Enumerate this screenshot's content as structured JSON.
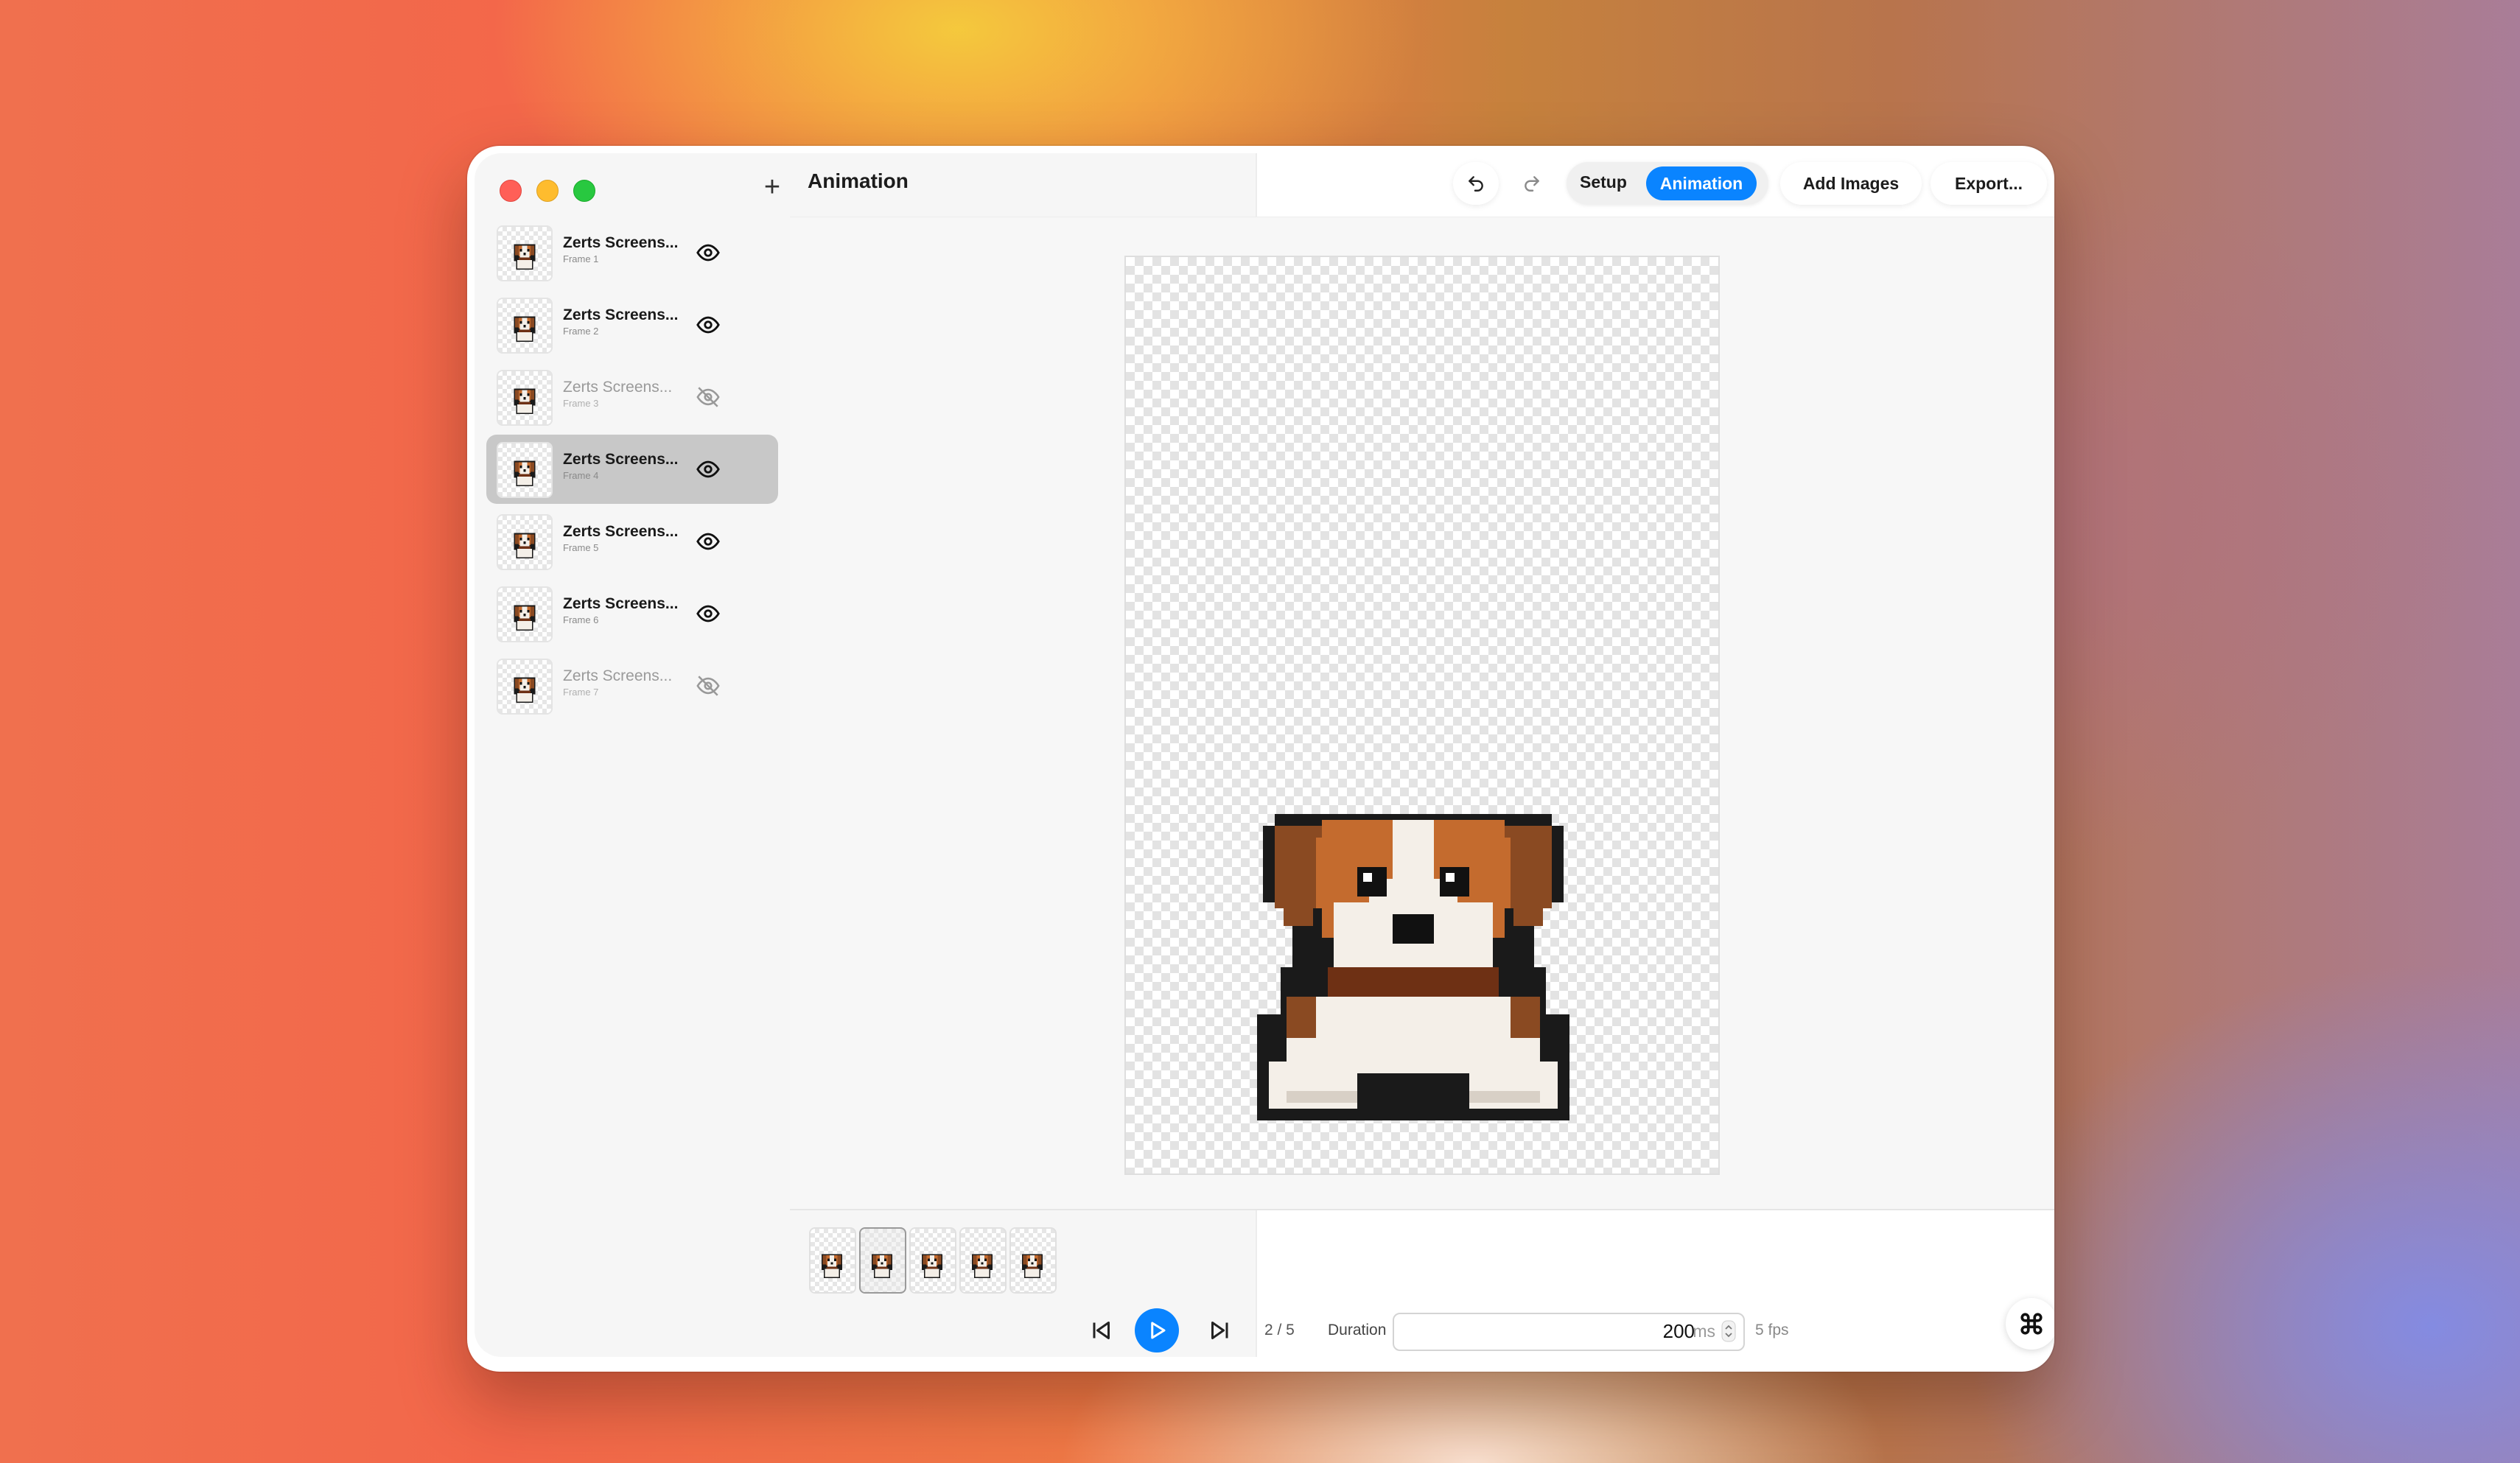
{
  "window": {
    "title": "Animation"
  },
  "sidebar": {
    "add_label": "+",
    "frames": [
      {
        "name": "Zerts Screens...",
        "sub": "Frame 1",
        "visible": true,
        "selected": false
      },
      {
        "name": "Zerts Screens...",
        "sub": "Frame 2",
        "visible": true,
        "selected": false
      },
      {
        "name": "Zerts Screens...",
        "sub": "Frame 3",
        "visible": false,
        "selected": false
      },
      {
        "name": "Zerts Screens...",
        "sub": "Frame 4",
        "visible": true,
        "selected": true
      },
      {
        "name": "Zerts Screens...",
        "sub": "Frame 5",
        "visible": true,
        "selected": false
      },
      {
        "name": "Zerts Screens...",
        "sub": "Frame 6",
        "visible": true,
        "selected": false
      },
      {
        "name": "Zerts Screens...",
        "sub": "Frame 7",
        "visible": false,
        "selected": false
      }
    ]
  },
  "toolbar": {
    "setup_label": "Setup",
    "animation_label": "Animation",
    "add_images_label": "Add Images",
    "export_label": "Export..."
  },
  "playback": {
    "counter": "2 / 5",
    "duration_label": "Duration",
    "duration_value": "200",
    "duration_unit": "ms",
    "fps": "5 fps",
    "active_strip_index": 1,
    "strip_count": 5
  },
  "colors": {
    "accent": "#0a84ff",
    "selected_row": "#c8c8c8"
  },
  "icons": {
    "undo": "undo-icon",
    "redo": "redo-icon",
    "eye": "eye-icon",
    "eye_off": "eye-off-icon",
    "prev": "skip-back-icon",
    "play": "play-icon",
    "next": "skip-forward-icon",
    "command": "command-icon"
  }
}
